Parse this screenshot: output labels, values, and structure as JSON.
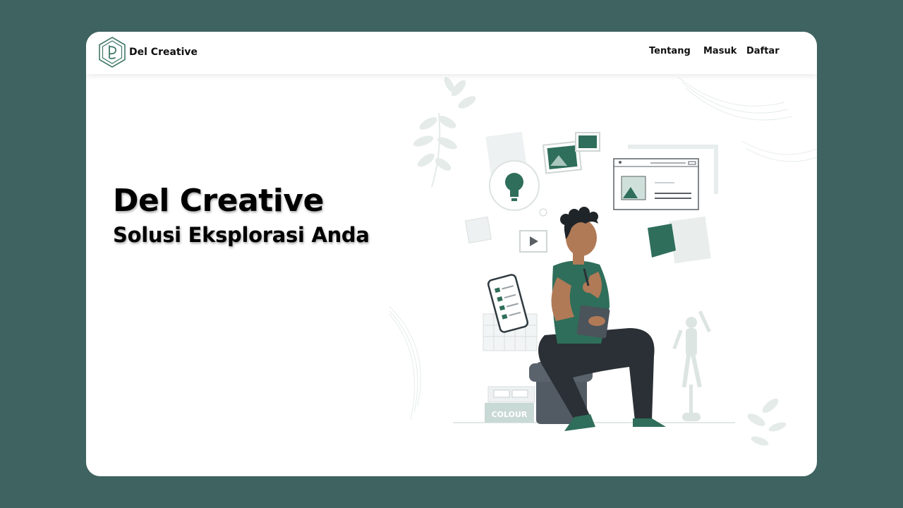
{
  "brand": {
    "name": "Del Creative",
    "logo_icon": "del-creative-hexagon-logo"
  },
  "nav": {
    "items": [
      {
        "label": "Tentang"
      },
      {
        "label": "Masuk"
      },
      {
        "label": "Daftar"
      }
    ]
  },
  "hero": {
    "title": "Del Creative",
    "subtitle": "Solusi Eksplorasi Anda",
    "illustration_colour_label": "COLOUR"
  },
  "colors": {
    "page_background": "#3e6360",
    "card_background": "#ffffff",
    "accent_green": "#2f6e5a",
    "text": "#111111"
  }
}
